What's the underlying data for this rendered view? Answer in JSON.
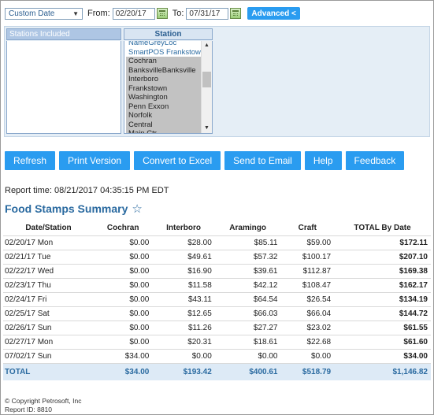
{
  "filters": {
    "range_value": "Custom Date",
    "from_label": "From:",
    "from_value": "02/20/17",
    "to_label": "To:",
    "to_value": "07/31/17",
    "advanced_label": "Advanced <"
  },
  "stations": {
    "included_label": "Stations Included",
    "station_header": "Station",
    "items": [
      {
        "name": "NameGreyLoc",
        "selected": false
      },
      {
        "name": "SmartPOS Frankstown",
        "selected": false
      },
      {
        "name": "Cochran",
        "selected": true
      },
      {
        "name": "BanksvilleBanksville",
        "selected": true
      },
      {
        "name": "Interboro",
        "selected": true
      },
      {
        "name": "Frankstown",
        "selected": true
      },
      {
        "name": "Washington",
        "selected": true
      },
      {
        "name": "Penn Exxon",
        "selected": true
      },
      {
        "name": "Norfolk",
        "selected": true
      },
      {
        "name": "Central",
        "selected": true
      },
      {
        "name": "Main Ctr",
        "selected": true
      }
    ]
  },
  "actions": [
    "Refresh",
    "Print Version",
    "Convert to Excel",
    "Send to Email",
    "Help",
    "Feedback"
  ],
  "report": {
    "time_text": "Report time: 08/21/2017 04:35:15 PM EDT",
    "title": "Food Stamps Summary"
  },
  "table": {
    "columns": [
      "Date/Station",
      "Cochran",
      "Interboro",
      "Aramingo",
      "Craft",
      "TOTAL By Date"
    ],
    "rows": [
      [
        "02/20/17 Mon",
        "$0.00",
        "$28.00",
        "$85.11",
        "$59.00",
        "$172.11"
      ],
      [
        "02/21/17 Tue",
        "$0.00",
        "$49.61",
        "$57.32",
        "$100.17",
        "$207.10"
      ],
      [
        "02/22/17 Wed",
        "$0.00",
        "$16.90",
        "$39.61",
        "$112.87",
        "$169.38"
      ],
      [
        "02/23/17 Thu",
        "$0.00",
        "$11.58",
        "$42.12",
        "$108.47",
        "$162.17"
      ],
      [
        "02/24/17 Fri",
        "$0.00",
        "$43.11",
        "$64.54",
        "$26.54",
        "$134.19"
      ],
      [
        "02/25/17 Sat",
        "$0.00",
        "$12.65",
        "$66.03",
        "$66.04",
        "$144.72"
      ],
      [
        "02/26/17 Sun",
        "$0.00",
        "$11.26",
        "$27.27",
        "$23.02",
        "$61.55"
      ],
      [
        "02/27/17 Mon",
        "$0.00",
        "$20.31",
        "$18.61",
        "$22.68",
        "$61.60"
      ],
      [
        "07/02/17 Sun",
        "$34.00",
        "$0.00",
        "$0.00",
        "$0.00",
        "$34.00"
      ]
    ],
    "total": [
      "TOTAL",
      "$34.00",
      "$193.42",
      "$400.61",
      "$518.79",
      "$1,146.82"
    ]
  },
  "footer": {
    "copyright": "© Copyright Petrosoft, Inc",
    "report_id": "Report ID: 8810"
  }
}
